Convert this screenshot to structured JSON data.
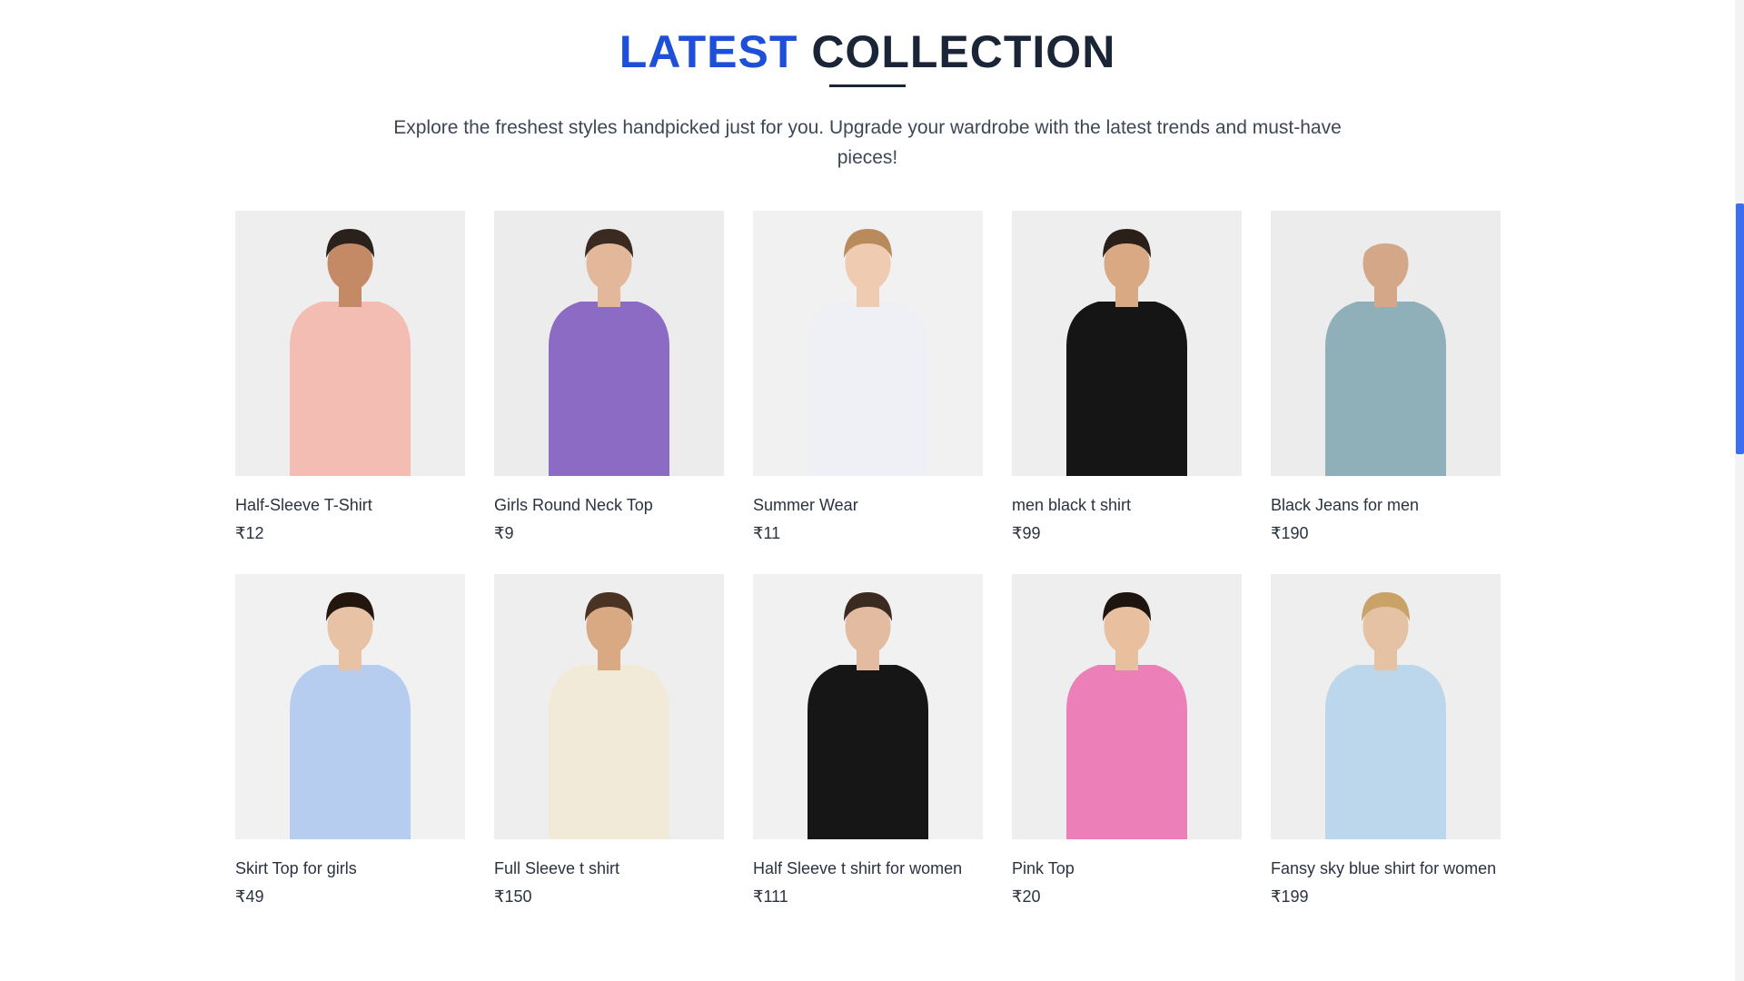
{
  "section": {
    "title_accent": "LATEST",
    "title_rest": "COLLECTION",
    "subtitle": "Explore the freshest styles handpicked just for you. Upgrade your wardrobe with the latest trends and must-have pieces!",
    "accent_color": "#1d4fd8",
    "heading_color": "#1a2638"
  },
  "products": [
    {
      "name": "Half-Sleeve T-Shirt",
      "price": "₹12",
      "image": "man-pink-shirt",
      "bg": "#eeeeee",
      "garment": "#f3bdb4",
      "skin": "#c48a66",
      "hair": "#2a211c",
      "bottom": "#f3bdb4"
    },
    {
      "name": "Girls Round Neck Top",
      "price": "₹9",
      "image": "woman-floral-top",
      "bg": "#ececec",
      "garment": "#8b6bc4",
      "skin": "#e2b79a",
      "hair": "#3b2a22",
      "bottom": "#8b6bc4"
    },
    {
      "name": "Summer Wear",
      "price": "₹11",
      "image": "girl-floral-dress",
      "bg": "#f1f1f1",
      "garment": "#eef0f5",
      "skin": "#efcbb2",
      "hair": "#b88a5c",
      "bottom": "#eef0f5"
    },
    {
      "name": "men black t shirt",
      "price": "₹99",
      "image": "man-black-tshirt",
      "bg": "#eeeeee",
      "garment": "#151515",
      "skin": "#d9a983",
      "hair": "#2b2019",
      "bottom": "#151515"
    },
    {
      "name": "Black Jeans for men",
      "price": "₹190",
      "image": "black-jeans",
      "bg": "#ececec",
      "garment": "#8fb0b8",
      "skin": "#d4a789",
      "hair": "#ececec",
      "bottom": "#141a26"
    },
    {
      "name": "Skirt Top for girls",
      "price": "₹49",
      "image": "girl-blue-top",
      "bg": "#f1f1f1",
      "garment": "#b7cdf0",
      "skin": "#e8c2a4",
      "hair": "#22160f",
      "bottom": "#f4d2de"
    },
    {
      "name": "Full Sleeve t shirt",
      "price": "₹150",
      "image": "man-striped-rugby",
      "bg": "#eeeeee",
      "garment": "#f1ead8",
      "skin": "#d9a983",
      "hair": "#4a3322",
      "bottom": "#d8c7a2"
    },
    {
      "name": "Half Sleeve t shirt for women",
      "price": "₹111",
      "image": "woman-black-tshirt",
      "bg": "#f1f1f1",
      "garment": "#161616",
      "skin": "#e2bba0",
      "hair": "#3a2a20",
      "bottom": "#161616"
    },
    {
      "name": "Pink Top",
      "price": "₹20",
      "image": "girl-pink-top",
      "bg": "#eeeeee",
      "garment": "#ec7fb8",
      "skin": "#e8c0a0",
      "hair": "#1e1410",
      "bottom": "#f1e4ea"
    },
    {
      "name": "Fansy sky blue shirt for women",
      "price": "₹199",
      "image": "woman-blue-shirt",
      "bg": "#eeeeee",
      "garment": "#bcd6ec",
      "skin": "#e6c2a5",
      "hair": "#c9a268",
      "bottom": "#1a1a1a"
    }
  ],
  "scrollbar": {
    "thumb_color": "#3b6ff0"
  }
}
